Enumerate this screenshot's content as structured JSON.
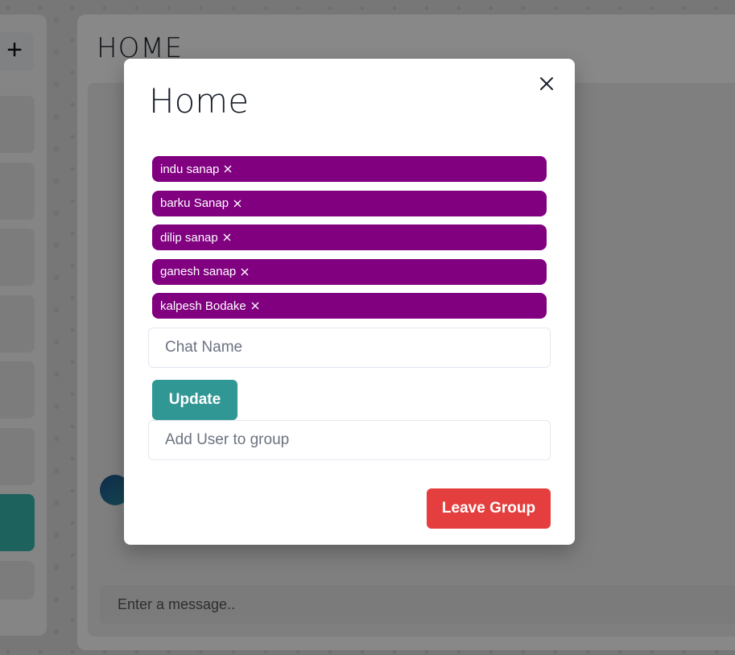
{
  "background": {
    "add_label": "+",
    "chat_title": "HOME",
    "message_placeholder": "Enter a message.."
  },
  "modal": {
    "title": "Home",
    "close_icon": "close-icon",
    "members": [
      {
        "name": "indu sanap"
      },
      {
        "name": "barku Sanap"
      },
      {
        "name": "dilip sanap"
      },
      {
        "name": "ganesh sanap"
      },
      {
        "name": "kalpesh Bodake"
      }
    ],
    "chat_name_placeholder": "Chat Name",
    "update_label": "Update",
    "add_user_placeholder": "Add User to group",
    "leave_label": "Leave Group"
  },
  "colors": {
    "badge": "#800080",
    "update": "#319795",
    "leave": "#e53e3e"
  }
}
